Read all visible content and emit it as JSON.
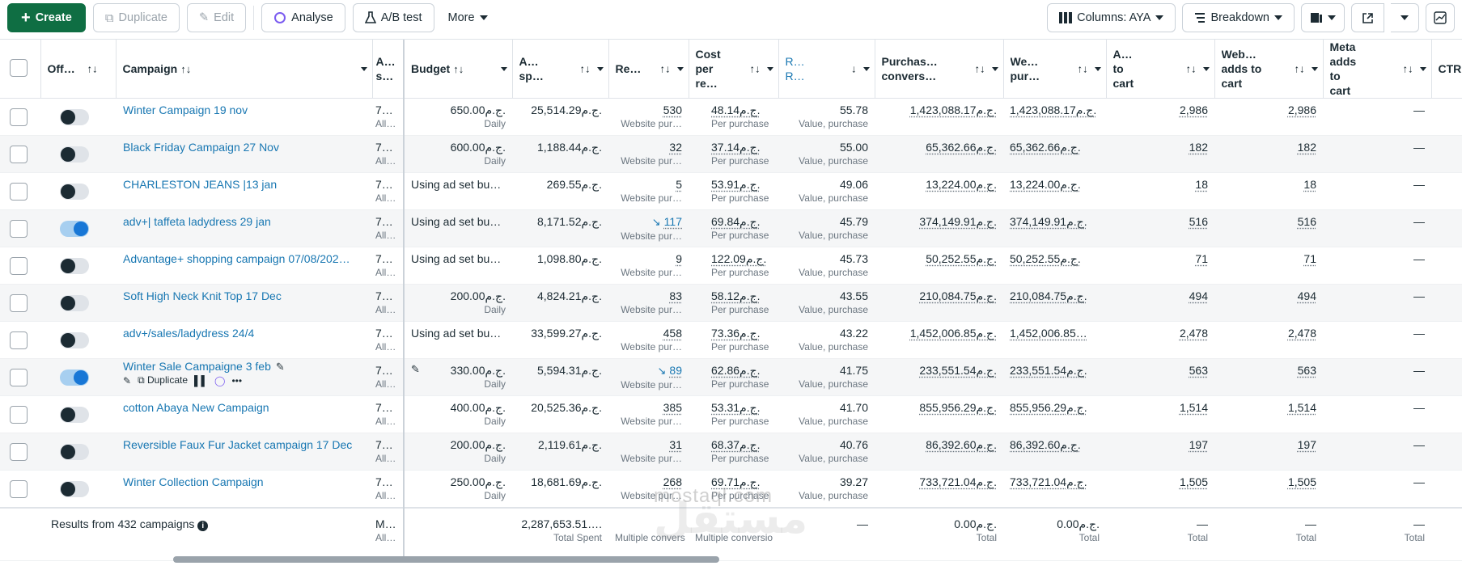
{
  "toolbar": {
    "create": "Create",
    "duplicate": "Duplicate",
    "edit": "Edit",
    "analyse": "Analyse",
    "ab_test": "A/B test",
    "more": "More",
    "columns": "Columns: AYA",
    "breakdown": "Breakdown"
  },
  "headers": {
    "off": "Off…",
    "campaign": "Campaign",
    "a": "A… s…",
    "budget": "Budget",
    "amount_spent": "Amount spent",
    "results": "Re…",
    "cost": "Cost per result",
    "roas": "Results ROAS",
    "purchases_conv": "Purchases conversion…",
    "website_purchases": "Website purchas…",
    "adds_to_cart": "Adds to cart",
    "website_adds": "Website adds to cart",
    "meta_adds": "Meta adds to cart",
    "ctr": "CTR"
  },
  "rows": [
    {
      "name": "Winter Campaign 19 nov",
      "on": false,
      "a": "7…",
      "a_sub": "All…",
      "budget": "650.00ج.م.",
      "budget_sub": "Daily",
      "spent": "25,514.29ج.م.",
      "results": "530",
      "results_sub": "Website pur…",
      "cost": "48.14ج.م.",
      "cost_sub": "Per purchase",
      "roas": "55.78",
      "roas_sub": "Value, purchase",
      "purch": "1,423,088.17ج.م.",
      "wpurch": "1,423,088.17ج.م.",
      "atc": "2,986",
      "watc": "2,986",
      "meta": "—"
    },
    {
      "name": "Black Friday Campaign 27 Nov",
      "on": false,
      "a": "7…",
      "a_sub": "All…",
      "budget": "600.00ج.م.",
      "budget_sub": "Daily",
      "spent": "1,188.44ج.م.",
      "results": "32",
      "results_sub": "Website pur…",
      "cost": "37.14ج.م.",
      "cost_sub": "Per purchase",
      "roas": "55.00",
      "roas_sub": "Value, purchase",
      "purch": "65,362.66ج.م.",
      "wpurch": "65,362.66ج.م.",
      "atc": "182",
      "watc": "182",
      "meta": "—"
    },
    {
      "name": "CHARLESTON JEANS |13 jan",
      "on": false,
      "a": "7…",
      "a_sub": "All…",
      "budget": "Using ad set bu…",
      "budget_sub": "",
      "spent": "269.55ج.م.",
      "results": "5",
      "results_sub": "Website pur…",
      "cost": "53.91ج.م.",
      "cost_sub": "Per purchase",
      "roas": "49.06",
      "roas_sub": "Value, purchase",
      "purch": "13,224.00ج.م.",
      "wpurch": "13,224.00ج.م.",
      "atc": "18",
      "watc": "18",
      "meta": "—"
    },
    {
      "name": "adv+| taffeta ladydress 29 jan",
      "on": true,
      "a": "7…",
      "a_sub": "All…",
      "budget": "Using ad set bu…",
      "budget_sub": "",
      "spent": "8,171.52ج.م.",
      "results": "117",
      "trend": true,
      "results_sub": "Website pur…",
      "cost": "69.84ج.م.",
      "cost_sub": "Per purchase",
      "roas": "45.79",
      "roas_sub": "Value, purchase",
      "purch": "374,149.91ج.م.",
      "wpurch": "374,149.91ج.م.",
      "atc": "516",
      "watc": "516",
      "meta": "—"
    },
    {
      "name": "Advantage+ shopping campaign 07/08/202…",
      "on": false,
      "a": "7…",
      "a_sub": "All…",
      "budget": "Using ad set bu…",
      "budget_sub": "",
      "spent": "1,098.80ج.م.",
      "results": "9",
      "results_sub": "Website pur…",
      "cost": "122.09ج.م.",
      "cost_sub": "Per purchase",
      "roas": "45.73",
      "roas_sub": "Value, purchase",
      "purch": "50,252.55ج.م.",
      "wpurch": "50,252.55ج.م.",
      "atc": "71",
      "watc": "71",
      "meta": "—"
    },
    {
      "name": "Soft High Neck Knit Top 17 Dec",
      "on": false,
      "a": "7…",
      "a_sub": "All…",
      "budget": "200.00ج.م.",
      "budget_sub": "Daily",
      "spent": "4,824.21ج.م.",
      "results": "83",
      "results_sub": "Website pur…",
      "cost": "58.12ج.م.",
      "cost_sub": "Per purchase",
      "roas": "43.55",
      "roas_sub": "Value, purchase",
      "purch": "210,084.75ج.م.",
      "wpurch": "210,084.75ج.م.",
      "atc": "494",
      "watc": "494",
      "meta": "—"
    },
    {
      "name": "adv+/sales/ladydress 24/4",
      "on": false,
      "a": "7…",
      "a_sub": "All…",
      "budget": "Using ad set bu…",
      "budget_sub": "",
      "spent": "33,599.27ج.م.",
      "results": "458",
      "results_sub": "Website pur…",
      "cost": "73.36ج.م.",
      "cost_sub": "Per purchase",
      "roas": "43.22",
      "roas_sub": "Value, purchase",
      "purch": "1,452,006.85ج.م.",
      "wpurch": "1,452,006.85…",
      "atc": "2,478",
      "watc": "2,478",
      "meta": "—"
    },
    {
      "name": "Winter Sale Campaigne 3 feb",
      "on": true,
      "hover": true,
      "a": "7…",
      "a_sub": "All…",
      "budget": "330.00ج.م.",
      "budget_sub": "Daily",
      "spent": "5,594.31ج.م.",
      "results": "89",
      "trend": true,
      "results_sub": "Website pur…",
      "cost": "62.86ج.م.",
      "cost_sub": "Per purchase",
      "roas": "41.75",
      "roas_sub": "Value, purchase",
      "purch": "233,551.54ج.م.",
      "wpurch": "233,551.54ج.م.",
      "atc": "563",
      "watc": "563",
      "meta": "—"
    },
    {
      "name": "cotton Abaya New Campaign",
      "on": false,
      "a": "7…",
      "a_sub": "All…",
      "budget": "400.00ج.م.",
      "budget_sub": "Daily",
      "spent": "20,525.36ج.م.",
      "results": "385",
      "results_sub": "Website pur…",
      "cost": "53.31ج.م.",
      "cost_sub": "Per purchase",
      "roas": "41.70",
      "roas_sub": "Value, purchase",
      "purch": "855,956.29ج.م.",
      "wpurch": "855,956.29ج.م.",
      "atc": "1,514",
      "watc": "1,514",
      "meta": "—"
    },
    {
      "name": "Reversible Faux Fur Jacket campaign 17 Dec",
      "on": false,
      "a": "7…",
      "a_sub": "All…",
      "budget": "200.00ج.م.",
      "budget_sub": "Daily",
      "spent": "2,119.61ج.م.",
      "results": "31",
      "results_sub": "Website pur…",
      "cost": "68.37ج.م.",
      "cost_sub": "Per purchase",
      "roas": "40.76",
      "roas_sub": "Value, purchase",
      "purch": "86,392.60ج.م.",
      "wpurch": "86,392.60ج.م.",
      "atc": "197",
      "watc": "197",
      "meta": "—"
    },
    {
      "name": "Winter Collection Campaign",
      "on": false,
      "a": "7…",
      "a_sub": "All…",
      "budget": "250.00ج.م.",
      "budget_sub": "Daily",
      "spent": "18,681.69ج.م.",
      "results": "268",
      "results_sub": "Website pur…",
      "cost": "69.71ج.م.",
      "cost_sub": "Per purchase",
      "roas": "39.27",
      "roas_sub": "Value, purchase",
      "purch": "733,721.04ج.م.",
      "wpurch": "733,721.04ج.م.",
      "atc": "1,505",
      "watc": "1,505",
      "meta": "—"
    }
  ],
  "row_actions": {
    "duplicate": "Duplicate"
  },
  "footer": {
    "label": "Results from 432 campaigns",
    "a": "M…",
    "a_sub": "All…",
    "spent": "2,287,653.51….",
    "spent_sub": "Total Spent",
    "results_sub": "Multiple convers",
    "cost_sub": "Multiple conversio",
    "roas": "—",
    "purch": "0.00ج.م.",
    "purch_sub": "Total",
    "wpurch": "0.00ج.م.",
    "wpurch_sub": "Total",
    "atc": "—",
    "atc_sub": "Total",
    "watc": "—",
    "watc_sub": "Total",
    "meta": "—",
    "meta_sub": "Total"
  },
  "watermark": {
    "line1": "mostaql.com",
    "line2": "مستقل"
  },
  "colors": {
    "primary": "#0f6e43",
    "link": "#1877b2",
    "toggle_on": "#1877d6"
  }
}
